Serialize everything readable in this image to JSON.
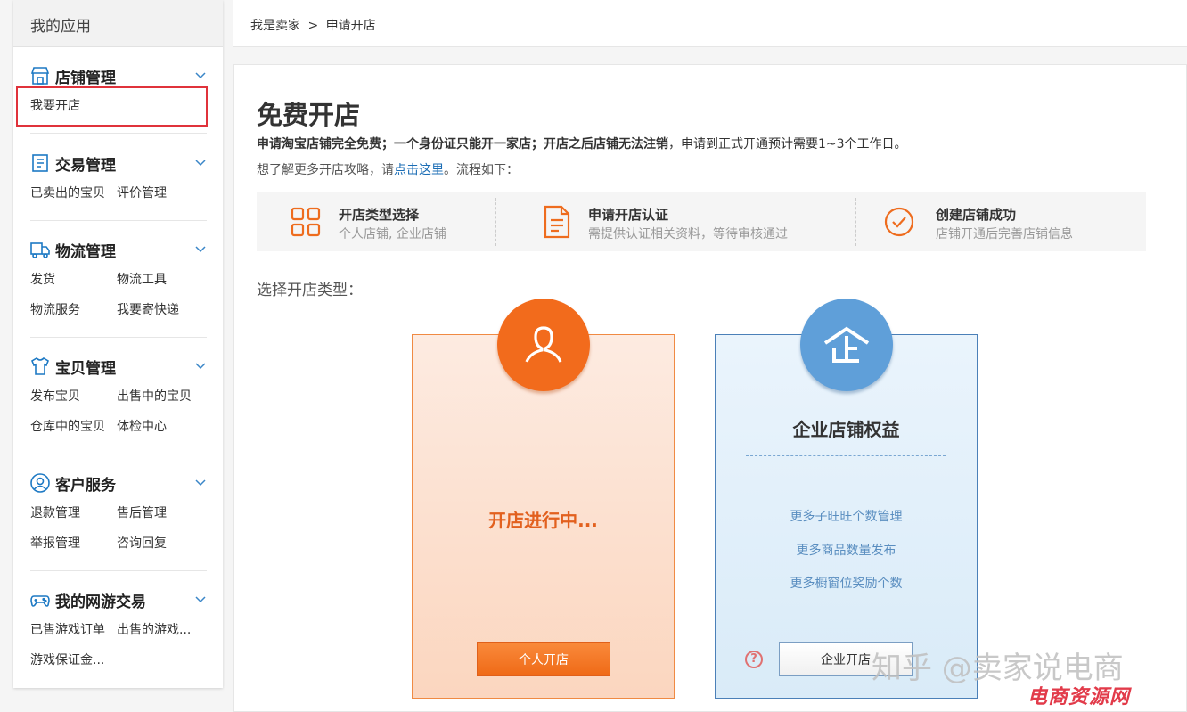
{
  "sidebar": {
    "title": "我的应用",
    "groups": [
      {
        "icon": "store-icon",
        "title": "店铺管理",
        "links": [
          "我要开店"
        ]
      },
      {
        "icon": "receipt-icon",
        "title": "交易管理",
        "links": [
          "已卖出的宝贝",
          "评价管理"
        ]
      },
      {
        "icon": "truck-icon",
        "title": "物流管理",
        "links": [
          "发货",
          "物流工具",
          "物流服务",
          "我要寄快递"
        ]
      },
      {
        "icon": "shirt-icon",
        "title": "宝贝管理",
        "links": [
          "发布宝贝",
          "出售中的宝贝",
          "仓库中的宝贝",
          "体检中心"
        ]
      },
      {
        "icon": "user-circle-icon",
        "title": "客户服务",
        "links": [
          "退款管理",
          "售后管理",
          "举报管理",
          "咨询回复"
        ]
      },
      {
        "icon": "gamepad-icon",
        "title": "我的网游交易",
        "links": [
          "已售游戏订单",
          "出售的游戏...",
          "游戏保证金..."
        ]
      }
    ]
  },
  "breadcrumb": {
    "root": "我是卖家",
    "sep": ">",
    "current": "申请开店"
  },
  "main": {
    "title": "免费开店",
    "notice_bold1": "申请淘宝店铺完全免费；一个身份证只能开一家店；开店之后店铺无法注销",
    "notice_rest": "，申请到正式开通预计需要1~3个工作日。",
    "guide_prefix": "想了解更多开店攻略，请",
    "guide_link": "点击这里",
    "guide_suffix": "。流程如下：",
    "steps": [
      {
        "icon": "grid-icon",
        "title": "开店类型选择",
        "desc": "个人店铺, 企业店铺"
      },
      {
        "icon": "document-icon",
        "title": "申请开店认证",
        "desc": "需提供认证相关资料，等待审核通过"
      },
      {
        "icon": "check-circle-icon",
        "title": "创建店铺成功",
        "desc": "店铺开通后完善店铺信息"
      }
    ],
    "choose_label": "选择开店类型："
  },
  "personal_card": {
    "status": "开店进行中...",
    "button": "个人开店"
  },
  "enterprise_card": {
    "title": "企业店铺权益",
    "benefits": [
      "更多子旺旺个数管理",
      "更多商品数量发布",
      "更多橱窗位奖励个数"
    ],
    "help": "?",
    "button": "企业开店"
  },
  "watermarks": {
    "zhihu": "知乎 @卖家说电商",
    "site": "电商资源网"
  },
  "colors": {
    "accent_orange": "#f26b1c",
    "accent_blue": "#5f9fd9",
    "link": "#1b6db5",
    "highlight_red": "#e0323b"
  }
}
